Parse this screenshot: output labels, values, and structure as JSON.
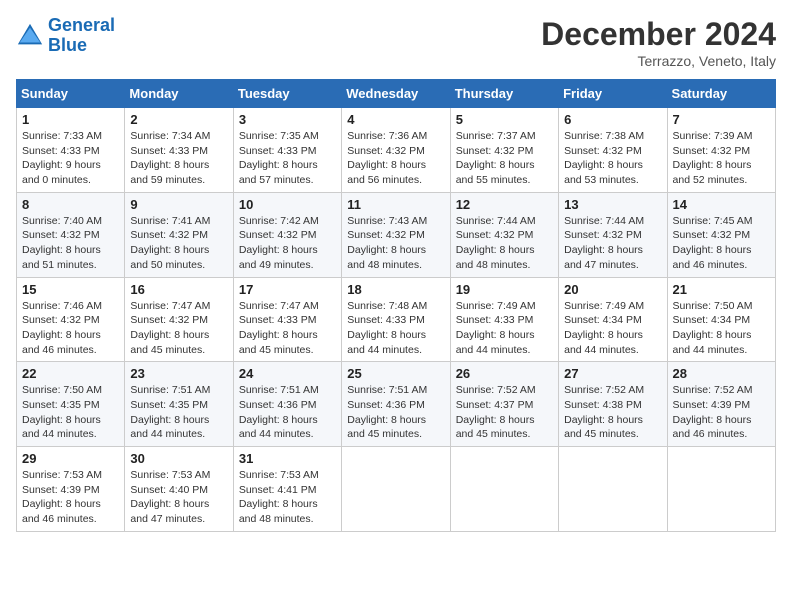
{
  "header": {
    "logo_line1": "General",
    "logo_line2": "Blue",
    "month": "December 2024",
    "location": "Terrazzo, Veneto, Italy"
  },
  "weekdays": [
    "Sunday",
    "Monday",
    "Tuesday",
    "Wednesday",
    "Thursday",
    "Friday",
    "Saturday"
  ],
  "weeks": [
    [
      {
        "day": "1",
        "sunrise": "7:33 AM",
        "sunset": "4:33 PM",
        "daylight": "9 hours and 0 minutes."
      },
      {
        "day": "2",
        "sunrise": "7:34 AM",
        "sunset": "4:33 PM",
        "daylight": "8 hours and 59 minutes."
      },
      {
        "day": "3",
        "sunrise": "7:35 AM",
        "sunset": "4:33 PM",
        "daylight": "8 hours and 57 minutes."
      },
      {
        "day": "4",
        "sunrise": "7:36 AM",
        "sunset": "4:32 PM",
        "daylight": "8 hours and 56 minutes."
      },
      {
        "day": "5",
        "sunrise": "7:37 AM",
        "sunset": "4:32 PM",
        "daylight": "8 hours and 55 minutes."
      },
      {
        "day": "6",
        "sunrise": "7:38 AM",
        "sunset": "4:32 PM",
        "daylight": "8 hours and 53 minutes."
      },
      {
        "day": "7",
        "sunrise": "7:39 AM",
        "sunset": "4:32 PM",
        "daylight": "8 hours and 52 minutes."
      }
    ],
    [
      {
        "day": "8",
        "sunrise": "7:40 AM",
        "sunset": "4:32 PM",
        "daylight": "8 hours and 51 minutes."
      },
      {
        "day": "9",
        "sunrise": "7:41 AM",
        "sunset": "4:32 PM",
        "daylight": "8 hours and 50 minutes."
      },
      {
        "day": "10",
        "sunrise": "7:42 AM",
        "sunset": "4:32 PM",
        "daylight": "8 hours and 49 minutes."
      },
      {
        "day": "11",
        "sunrise": "7:43 AM",
        "sunset": "4:32 PM",
        "daylight": "8 hours and 48 minutes."
      },
      {
        "day": "12",
        "sunrise": "7:44 AM",
        "sunset": "4:32 PM",
        "daylight": "8 hours and 48 minutes."
      },
      {
        "day": "13",
        "sunrise": "7:44 AM",
        "sunset": "4:32 PM",
        "daylight": "8 hours and 47 minutes."
      },
      {
        "day": "14",
        "sunrise": "7:45 AM",
        "sunset": "4:32 PM",
        "daylight": "8 hours and 46 minutes."
      }
    ],
    [
      {
        "day": "15",
        "sunrise": "7:46 AM",
        "sunset": "4:32 PM",
        "daylight": "8 hours and 46 minutes."
      },
      {
        "day": "16",
        "sunrise": "7:47 AM",
        "sunset": "4:32 PM",
        "daylight": "8 hours and 45 minutes."
      },
      {
        "day": "17",
        "sunrise": "7:47 AM",
        "sunset": "4:33 PM",
        "daylight": "8 hours and 45 minutes."
      },
      {
        "day": "18",
        "sunrise": "7:48 AM",
        "sunset": "4:33 PM",
        "daylight": "8 hours and 44 minutes."
      },
      {
        "day": "19",
        "sunrise": "7:49 AM",
        "sunset": "4:33 PM",
        "daylight": "8 hours and 44 minutes."
      },
      {
        "day": "20",
        "sunrise": "7:49 AM",
        "sunset": "4:34 PM",
        "daylight": "8 hours and 44 minutes."
      },
      {
        "day": "21",
        "sunrise": "7:50 AM",
        "sunset": "4:34 PM",
        "daylight": "8 hours and 44 minutes."
      }
    ],
    [
      {
        "day": "22",
        "sunrise": "7:50 AM",
        "sunset": "4:35 PM",
        "daylight": "8 hours and 44 minutes."
      },
      {
        "day": "23",
        "sunrise": "7:51 AM",
        "sunset": "4:35 PM",
        "daylight": "8 hours and 44 minutes."
      },
      {
        "day": "24",
        "sunrise": "7:51 AM",
        "sunset": "4:36 PM",
        "daylight": "8 hours and 44 minutes."
      },
      {
        "day": "25",
        "sunrise": "7:51 AM",
        "sunset": "4:36 PM",
        "daylight": "8 hours and 45 minutes."
      },
      {
        "day": "26",
        "sunrise": "7:52 AM",
        "sunset": "4:37 PM",
        "daylight": "8 hours and 45 minutes."
      },
      {
        "day": "27",
        "sunrise": "7:52 AM",
        "sunset": "4:38 PM",
        "daylight": "8 hours and 45 minutes."
      },
      {
        "day": "28",
        "sunrise": "7:52 AM",
        "sunset": "4:39 PM",
        "daylight": "8 hours and 46 minutes."
      }
    ],
    [
      {
        "day": "29",
        "sunrise": "7:53 AM",
        "sunset": "4:39 PM",
        "daylight": "8 hours and 46 minutes."
      },
      {
        "day": "30",
        "sunrise": "7:53 AM",
        "sunset": "4:40 PM",
        "daylight": "8 hours and 47 minutes."
      },
      {
        "day": "31",
        "sunrise": "7:53 AM",
        "sunset": "4:41 PM",
        "daylight": "8 hours and 48 minutes."
      },
      null,
      null,
      null,
      null
    ]
  ]
}
